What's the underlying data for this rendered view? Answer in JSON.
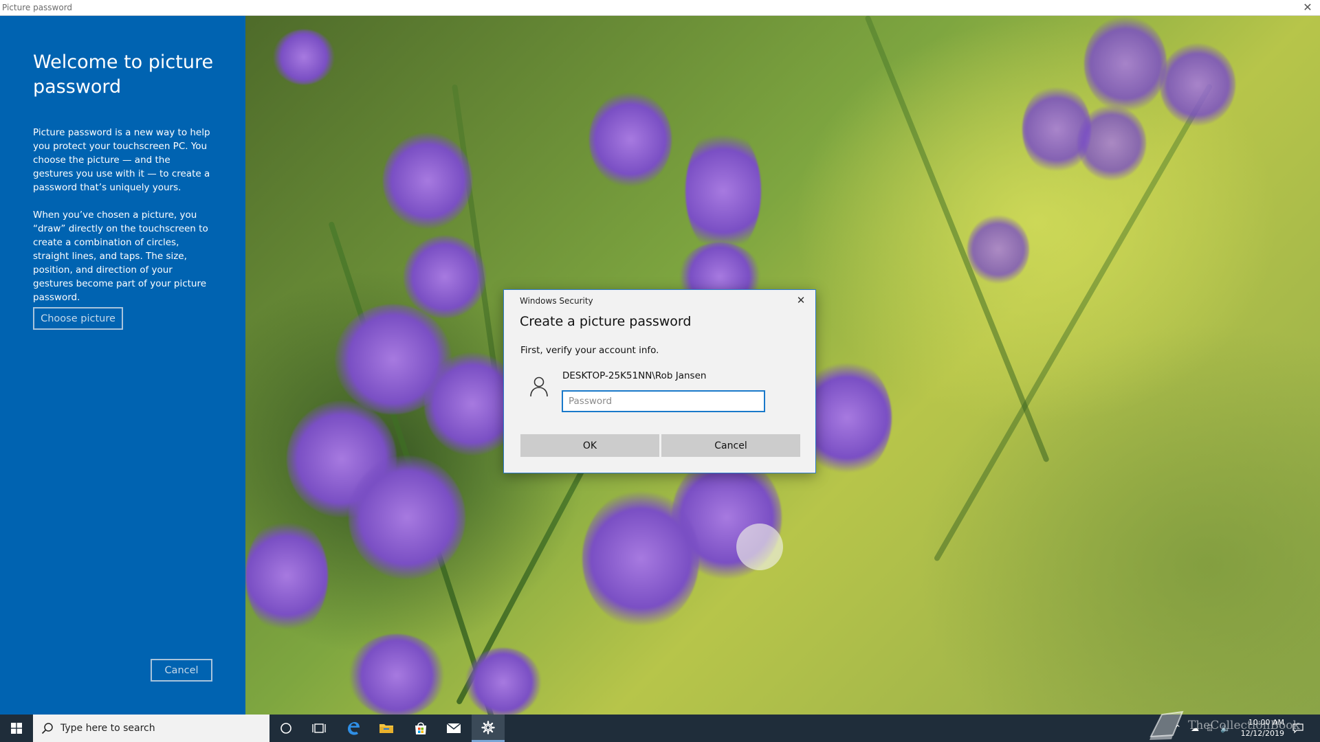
{
  "window": {
    "title": "Picture password",
    "close_glyph": "✕"
  },
  "left_panel": {
    "heading": "Welcome to picture password",
    "paragraph1": "Picture password is a new way to help you protect your touchscreen PC. You choose the picture — and the gestures you use with it — to create a password that’s uniquely yours.",
    "paragraph2": "When you’ve chosen a picture, you “draw” directly on the touchscreen to create a combination of circles, straight lines, and taps. The size, position, and direction of your gestures become part of your picture password.",
    "choose_button": "Choose picture",
    "cancel_button": "Cancel",
    "bg_color": "#0063b1"
  },
  "dialog": {
    "caption": "Windows Security",
    "title": "Create a picture password",
    "instruction": "First, verify your account info.",
    "account": "DESKTOP-25K51NN\\Rob Jansen",
    "password_placeholder": "Password",
    "password_value": "",
    "ok_button": "OK",
    "cancel_button": "Cancel",
    "close_glyph": "✕",
    "user_icon": "user-icon"
  },
  "taskbar": {
    "search_placeholder": "Type here to search",
    "icons": [
      "windows-start-icon",
      "cortana-icon",
      "task-view-icon",
      "edge-icon",
      "file-explorer-icon",
      "store-icon",
      "mail-icon",
      "settings-icon"
    ],
    "active_icon": "settings-icon",
    "clock_time": "10:00 AM",
    "clock_date": "12/12/2019"
  },
  "watermark": {
    "text": "TheCollectionBook"
  },
  "colors": {
    "accent": "#0078d7",
    "taskbar": "#1f2d3a",
    "dialog_border": "#2b79c9"
  }
}
